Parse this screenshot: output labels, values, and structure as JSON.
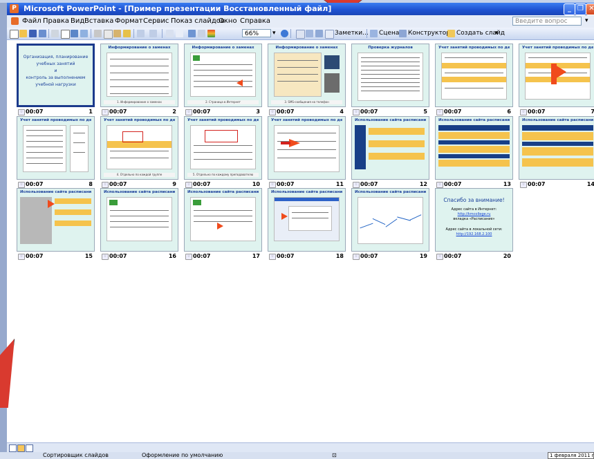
{
  "window": {
    "title": "Microsoft PowerPoint - [Пример презентации Восстановленный файл]",
    "app_icon": "powerpoint-icon"
  },
  "menu": {
    "items": [
      "Файл",
      "Правка",
      "Вид",
      "Вставка",
      "Формат",
      "Сервис",
      "Показ слайдов",
      "Окно",
      "Справка"
    ],
    "ask_placeholder": "Введите вопрос"
  },
  "toolbar": {
    "zoom": "66%",
    "notes_label": "Заметки...",
    "scene_label": "Сцена",
    "designer_label": "Конструктор",
    "new_slide_label": "Создать слайд"
  },
  "slides": [
    {
      "num": "1",
      "time": "00:07",
      "title": "",
      "intro": "Организация, планирование\nучебных занятий\nи\nконтроль за выполнением\nучебной нагрузки",
      "caption": ""
    },
    {
      "num": "2",
      "time": "00:07",
      "title": "Информирование о заменах",
      "caption": "1. Информирование о заменах"
    },
    {
      "num": "3",
      "time": "00:07",
      "title": "Информирование о заменах",
      "caption": "2. Страница в Интернет"
    },
    {
      "num": "4",
      "time": "00:07",
      "title": "Информирование о заменах",
      "caption": "3. SMS-сообщения на телефон"
    },
    {
      "num": "5",
      "time": "00:07",
      "title": "Проверка журналов",
      "caption": ""
    },
    {
      "num": "6",
      "time": "00:07",
      "title": "Учет занятий проводимых по делению",
      "caption": ""
    },
    {
      "num": "7",
      "time": "00:07",
      "title": "Учет занятий проводимых по делению",
      "caption": ""
    },
    {
      "num": "8",
      "time": "00:07",
      "title": "Учет занятий проводимых по делению",
      "caption": ""
    },
    {
      "num": "9",
      "time": "00:07",
      "title": "Учет занятий проводимых по делению",
      "caption": "4. Отдельно по каждой группе"
    },
    {
      "num": "10",
      "time": "00:07",
      "title": "Учет занятий проводимых по делению",
      "caption": "5. Отдельно по каждому преподавателю"
    },
    {
      "num": "11",
      "time": "00:07",
      "title": "Учет занятий проводимых по делению",
      "caption": ""
    },
    {
      "num": "12",
      "time": "00:07",
      "title": "Использование сайта расписания колледжа",
      "caption": ""
    },
    {
      "num": "13",
      "time": "00:07",
      "title": "Использование сайта расписания колледжа",
      "caption": ""
    },
    {
      "num": "14",
      "time": "00:07",
      "title": "Использование сайта расписания колледжа",
      "caption": ""
    },
    {
      "num": "15",
      "time": "00:07",
      "title": "Использование сайта расписания колледжа",
      "caption": ""
    },
    {
      "num": "16",
      "time": "00:07",
      "title": "Использование сайта расписания колледжа",
      "caption": ""
    },
    {
      "num": "17",
      "time": "00:07",
      "title": "Использование сайта расписания колледжа",
      "caption": ""
    },
    {
      "num": "18",
      "time": "00:07",
      "title": "Использование сайта расписания колледжа",
      "caption": ""
    },
    {
      "num": "19",
      "time": "00:07",
      "title": "Использование сайта расписания колледжа",
      "caption": ""
    },
    {
      "num": "20",
      "time": "00:07",
      "title": "Спасибо за внимание!",
      "caption": ""
    }
  ],
  "final_slide": {
    "line1": "Адрес сайта в Интернет:",
    "link1": "http://kmcollege.ru",
    "line2": "вкладка «Расписание»",
    "line3": "Адрес сайта в локальной сети:",
    "link2": "http://192.168.2.100"
  },
  "status": {
    "view": "Сортировщик слайдов",
    "design": "Оформление по умолчанию",
    "date": "1 февраля 2011 г."
  },
  "colors": {
    "title_bar": "#1f53d3",
    "selection": "#1b3a8c",
    "slide_bg": "#dff3ef",
    "accent_orange": "#f5c34d",
    "accent_red": "#d93a2f"
  }
}
